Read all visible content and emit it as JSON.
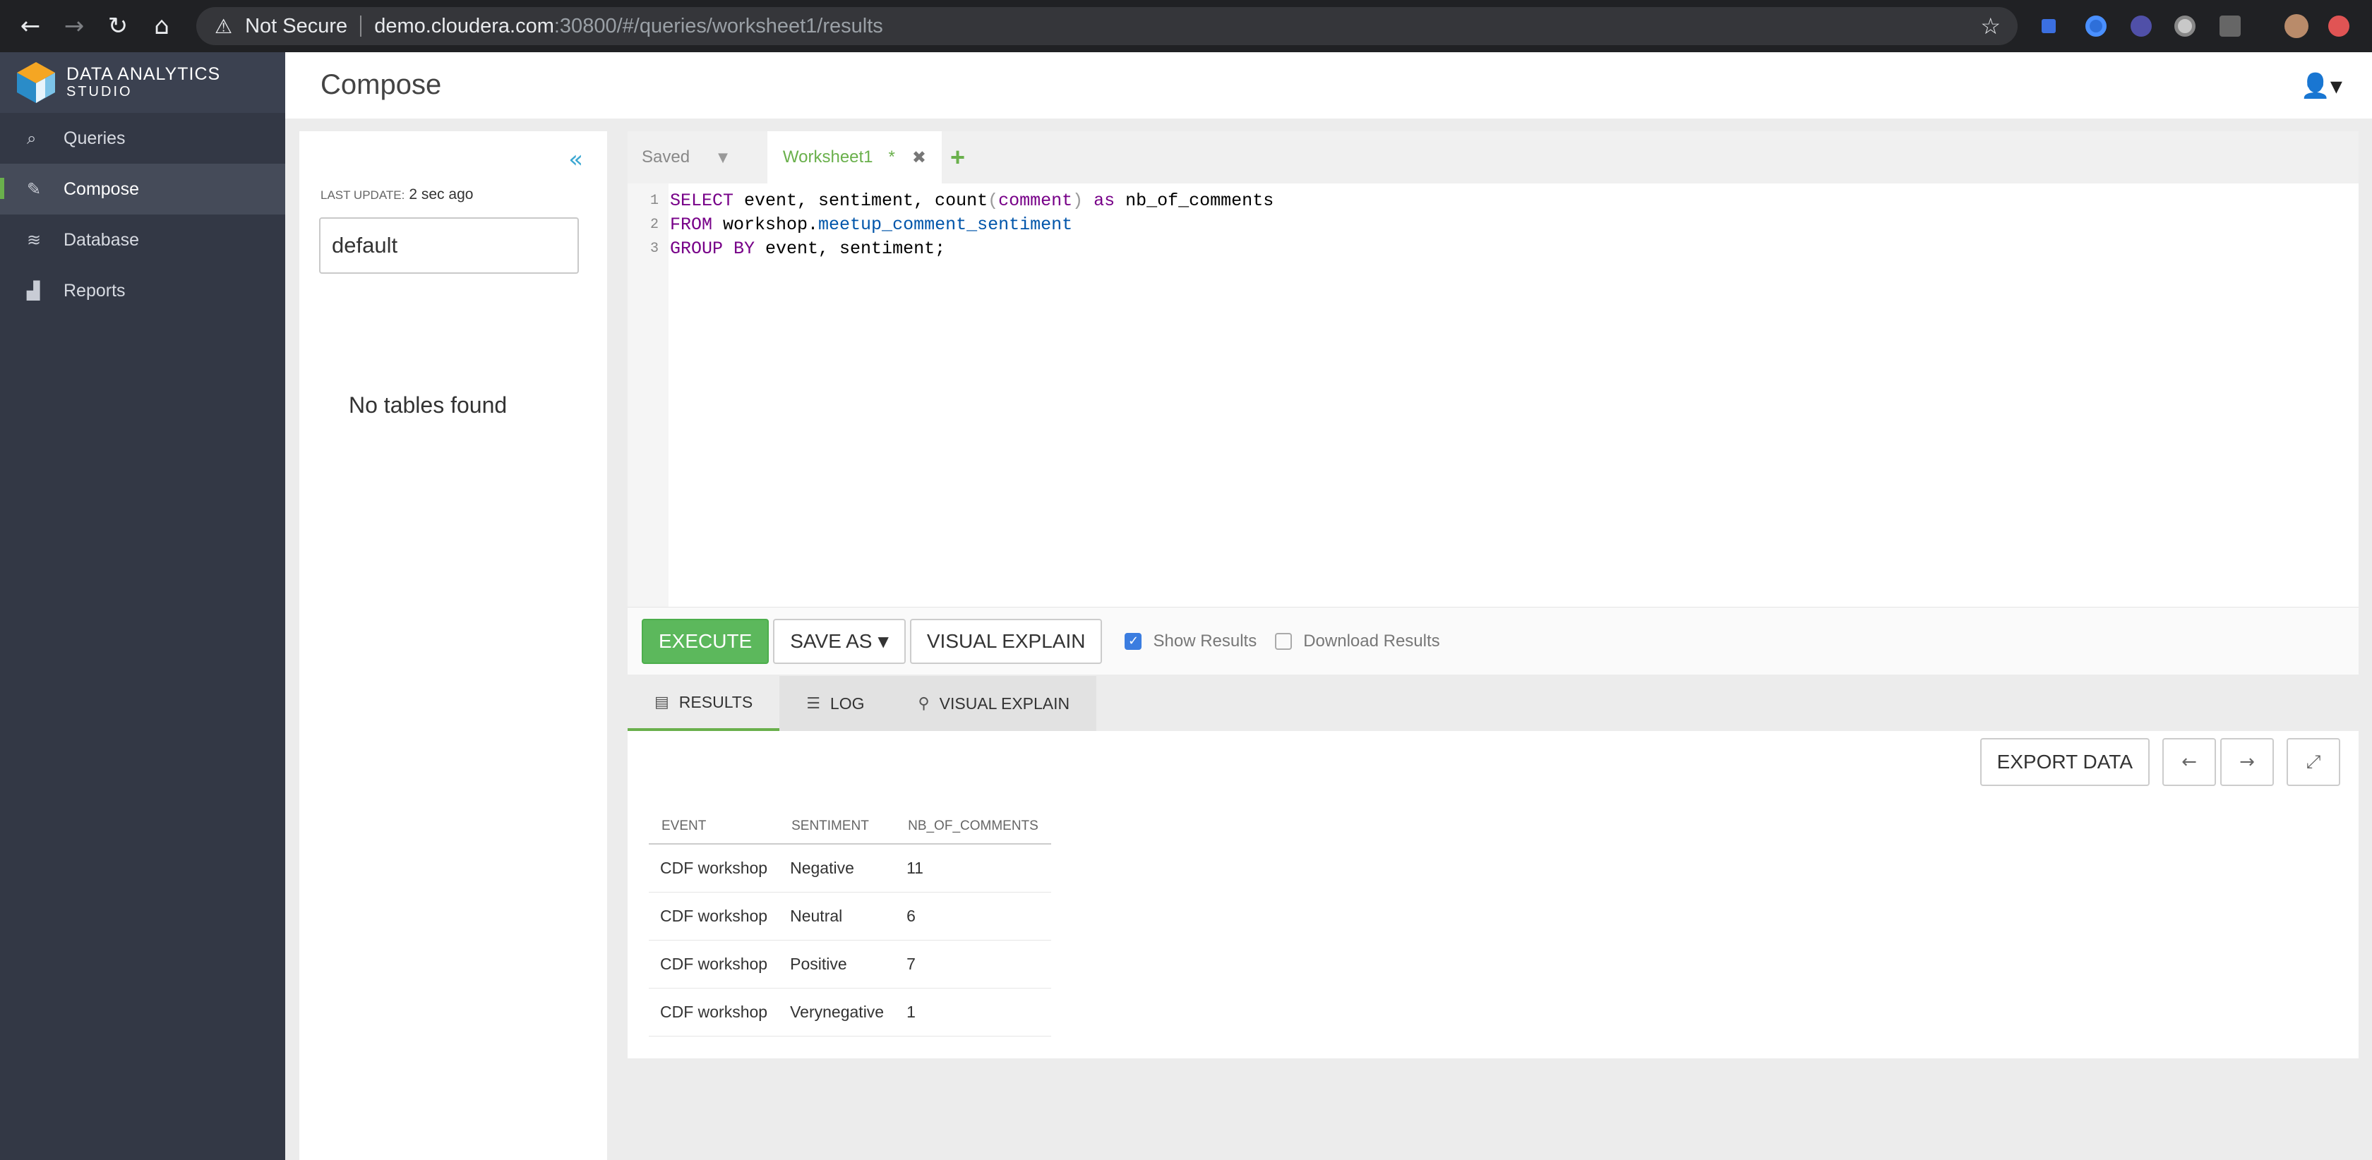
{
  "browser": {
    "security": "Not Secure",
    "url_host": "demo.cloudera.com",
    "url_path": ":30800/#/queries/worksheet1/results"
  },
  "brand": {
    "title": "DATA ANALYTICS",
    "subtitle": "STUDIO"
  },
  "sidebar": {
    "items": [
      {
        "label": "Queries",
        "icon": "search-icon"
      },
      {
        "label": "Compose",
        "icon": "edit-icon"
      },
      {
        "label": "Database",
        "icon": "database-icon"
      },
      {
        "label": "Reports",
        "icon": "chart-icon"
      }
    ]
  },
  "header": {
    "title": "Compose"
  },
  "left_panel": {
    "last_update_label": "LAST UPDATE:",
    "last_update_value": "2 sec ago",
    "database": "default",
    "empty_message": "No tables found"
  },
  "editor": {
    "tabs": {
      "saved": "Saved",
      "worksheet": "Worksheet1",
      "modified": "*"
    },
    "lines": [
      {
        "num": "1"
      },
      {
        "num": "2"
      },
      {
        "num": "3"
      }
    ],
    "code": {
      "l1_kw": "SELECT",
      "l1_a": " event, sentiment, count",
      "l1_p1": "(",
      "l1_arg": "comment",
      "l1_p2": ")",
      "l1_as": " as",
      "l1_b": " nb_of_comments",
      "l2_kw": "FROM",
      "l2_a": " workshop.",
      "l2_tbl": "meetup_comment_sentiment",
      "l3_kw": "GROUP BY",
      "l3_a": " event, sentiment;"
    }
  },
  "toolbar": {
    "execute": "EXECUTE",
    "save_as": "SAVE AS",
    "visual_explain": "VISUAL EXPLAIN",
    "show_results": "Show Results",
    "download_results": "Download Results"
  },
  "results_tabs": {
    "results": "RESULTS",
    "log": "LOG",
    "visual_explain": "VISUAL EXPLAIN"
  },
  "results": {
    "export": "EXPORT DATA",
    "columns": [
      "EVENT",
      "SENTIMENT",
      "NB_OF_COMMENTS"
    ],
    "rows": [
      [
        "CDF workshop",
        "Negative",
        "11"
      ],
      [
        "CDF workshop",
        "Neutral",
        "6"
      ],
      [
        "CDF workshop",
        "Positive",
        "7"
      ],
      [
        "CDF workshop",
        "Verynegative",
        "1"
      ]
    ]
  },
  "colors": {
    "accent": "#6ab04c",
    "sidebar": "#333845",
    "execute": "#5cb85c"
  }
}
